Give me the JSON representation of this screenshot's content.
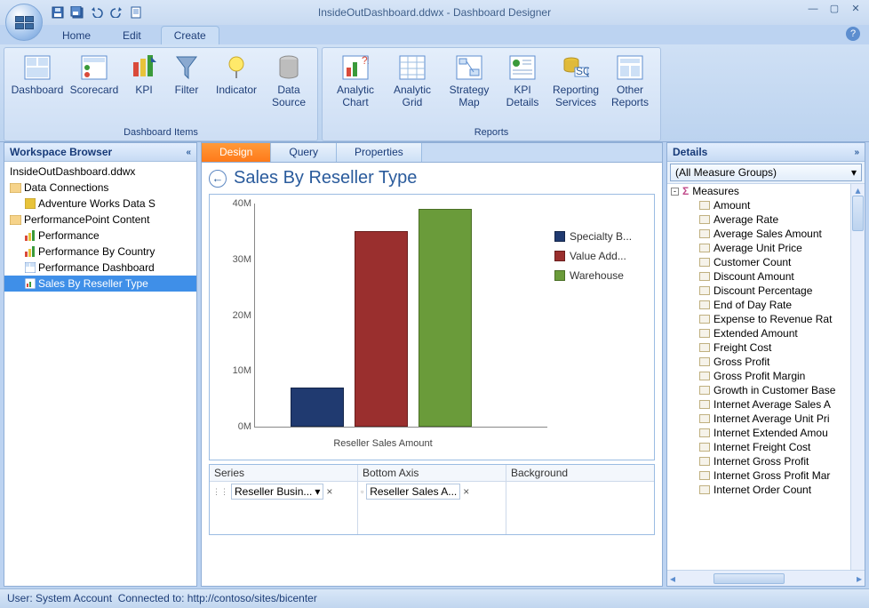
{
  "title": "InsideOutDashboard.ddwx - Dashboard Designer",
  "menu": {
    "home": "Home",
    "edit": "Edit",
    "create": "Create"
  },
  "ribbon": {
    "group1_label": "Dashboard Items",
    "group2_label": "Reports",
    "items1": {
      "dashboard": "Dashboard",
      "scorecard": "Scorecard",
      "kpi": "KPI",
      "filter": "Filter",
      "indicator": "Indicator",
      "datasource": "Data Source"
    },
    "items2": {
      "achart": "Analytic Chart",
      "agrid": "Analytic Grid",
      "smap": "Strategy Map",
      "kpid": "KPI Details",
      "rserv": "Reporting Services",
      "other": "Other Reports"
    }
  },
  "left": {
    "title": "Workspace Browser",
    "rows": [
      "InsideOutDashboard.ddwx",
      "Data Connections",
      "Adventure Works Data S",
      "PerformancePoint Content",
      "Performance",
      "Performance By Country",
      "Performance Dashboard",
      "Sales By Reseller Type"
    ]
  },
  "tabs": {
    "design": "Design",
    "query": "Query",
    "properties": "Properties"
  },
  "chart_title": "Sales By Reseller Type",
  "chart_data": {
    "type": "bar",
    "title": "Sales By Reseller Type",
    "xlabel": "Reseller Sales Amount",
    "ylabel": "",
    "ylim": [
      0,
      40000000
    ],
    "yticks": [
      "0M",
      "10M",
      "20M",
      "30M",
      "40M"
    ],
    "categories": [
      "Specialty Bike Shop",
      "Value Added Reseller",
      "Warehouse"
    ],
    "series": [
      {
        "name": "Specialty B...",
        "color": "#203a70",
        "value": 7000000
      },
      {
        "name": "Value Add...",
        "color": "#9a2f2e",
        "value": 35000000
      },
      {
        "name": "Warehouse",
        "color": "#6a9b3a",
        "value": 39000000
      }
    ]
  },
  "bottom": {
    "c1h": "Series",
    "c1v": "Reseller Busin...",
    "c2h": "Bottom Axis",
    "c2v": "Reseller Sales A...",
    "c3h": "Background"
  },
  "right": {
    "title": "Details",
    "combo": "(All Measure Groups)",
    "root": "Measures",
    "items": [
      "Amount",
      "Average Rate",
      "Average Sales Amount",
      "Average Unit Price",
      "Customer Count",
      "Discount Amount",
      "Discount Percentage",
      "End of Day Rate",
      "Expense to Revenue Rat",
      "Extended Amount",
      "Freight Cost",
      "Gross Profit",
      "Gross Profit Margin",
      "Growth in Customer Base",
      "Internet Average Sales A",
      "Internet Average Unit Pri",
      "Internet Extended Amou",
      "Internet Freight Cost",
      "Internet Gross Profit",
      "Internet Gross Profit Mar",
      "Internet Order Count"
    ]
  },
  "status": {
    "user": "User: System Account",
    "conn": "Connected to: http://contoso/sites/bicenter"
  }
}
